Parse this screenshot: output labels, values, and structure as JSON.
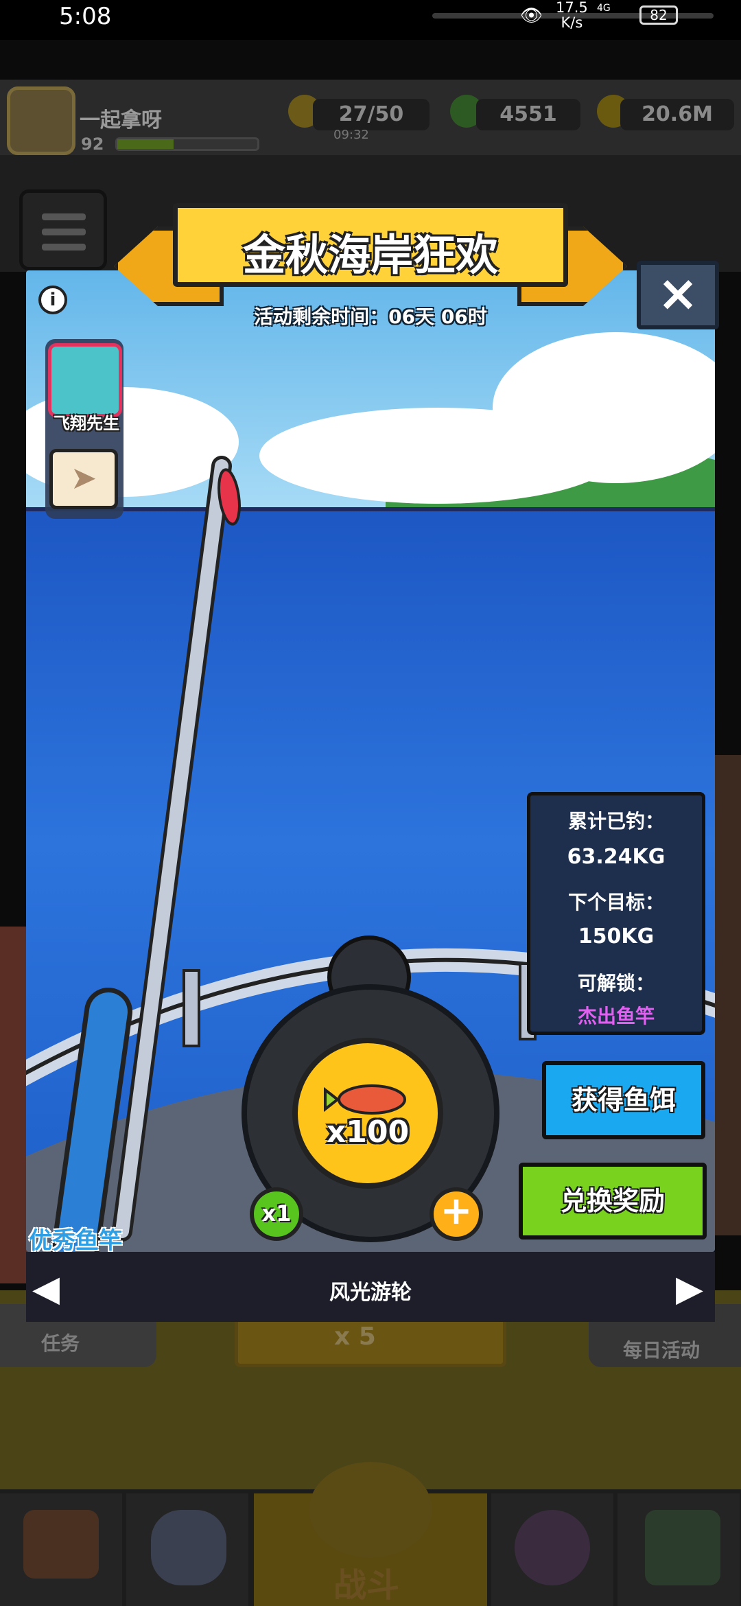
{
  "status_bar": {
    "time": "5:08",
    "net_speed": "17.5\nK/s",
    "network": "4G",
    "battery": "82"
  },
  "hud": {
    "player_name": "一起拿呀",
    "level": "92",
    "energy": "27/50",
    "energy_timer": "09:32",
    "gems": "4551",
    "coins": "20.6M"
  },
  "event": {
    "title": "金秋海岸狂欢",
    "countdown": "活动剩余时间：06天 06时",
    "captain_name": "飞翔先生",
    "stats": {
      "caught_label": "累计已钓：",
      "caught_value": "63.24KG",
      "next_label": "下个目标：",
      "next_value": "150KG",
      "unlock_label": "可解锁：",
      "unlock_value": "杰出鱼竿"
    },
    "bait_button": "获得鱼饵",
    "exchange_button": "兑换奖励",
    "bait_count": "x100",
    "multiplier": "x1",
    "rod_name": "优秀鱼竿",
    "ship_name": "风光游轮"
  },
  "background": {
    "left_card": "任务",
    "middle_card": "x 5",
    "right_card": "每日活动",
    "battle_label": "战斗"
  },
  "colors": {
    "banner": "#ffd23a",
    "bait_button": "#1aa8f0",
    "exchange_button": "#79d21e",
    "unlock_text": "#e060f0",
    "rod_label": "#2e9fe4"
  }
}
